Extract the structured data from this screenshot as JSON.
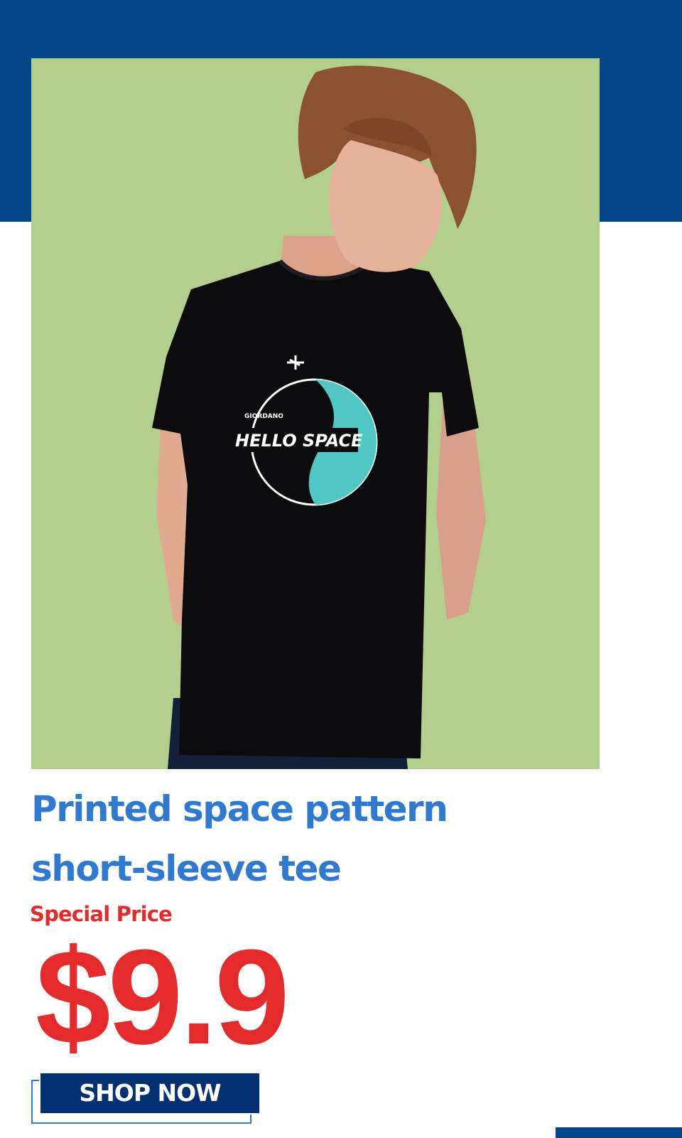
{
  "colors": {
    "brand_blue": "#03478a",
    "title_blue": "#2f7ad0",
    "price_red": "#e42a2a",
    "button_navy": "#032f73",
    "photo_background": "#b3cf8e"
  },
  "product": {
    "title_line_1": "Printed space pattern",
    "title_line_2": "short-sleeve tee",
    "price_label": "Special Price",
    "price": "$9.9",
    "tee_print": {
      "brand": "GIORDANO",
      "slogan": "HELLO SPACE"
    }
  },
  "cta": {
    "label": "SHOP NOW"
  }
}
